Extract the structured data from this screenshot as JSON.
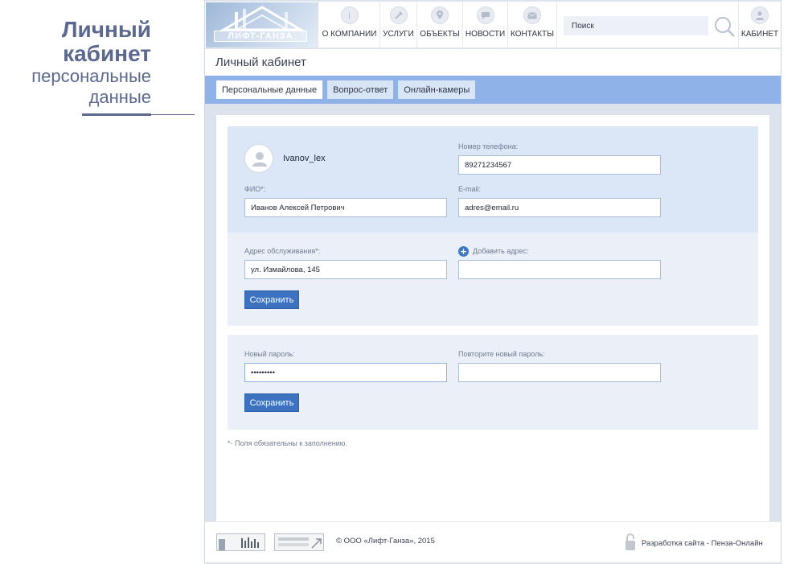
{
  "caption": {
    "title_line1": "Личный",
    "title_line2": "кабинет",
    "subtitle_line1": "персональные",
    "subtitle_line2": "данные"
  },
  "header": {
    "logo_text": "ЛИФТ-ГАНЗА",
    "nav": [
      {
        "label": "О КОМПАНИИ",
        "icon": "info-icon"
      },
      {
        "label": "УСЛУГИ",
        "icon": "wrench-icon"
      },
      {
        "label": "ОБЪЕКТЫ",
        "icon": "map-pin-icon"
      },
      {
        "label": "НОВОСТИ",
        "icon": "chat-icon"
      },
      {
        "label": "КОНТАКТЫ",
        "icon": "mail-icon"
      }
    ],
    "search_placeholder": "Поиск",
    "cabinet_label": "КАБИНЕТ"
  },
  "page_title": "Личный кабинет",
  "tabs": [
    {
      "label": "Персональные данные",
      "active": true
    },
    {
      "label": "Вопрос-ответ",
      "active": false
    },
    {
      "label": "Онлайн-камеры",
      "active": false
    }
  ],
  "profile": {
    "username": "Ivanov_lex",
    "phone_label": "Номер телефона:",
    "phone_value": "89271234567",
    "fio_label": "ФИО*:",
    "fio_value": "Иванов Алексей Петрович",
    "email_label": "E-mail:",
    "email_value": "adres@email.ru"
  },
  "address": {
    "label": "Адрес обслуживания*:",
    "value": "ул. Измайлова, 145",
    "add_label": "Добавить адрес:",
    "add_value": "",
    "save_label": "Сохранить"
  },
  "password": {
    "new_label": "Новый пароль:",
    "new_value": "•••••••••",
    "repeat_label": "Повторите новый пароль:",
    "repeat_value": "",
    "save_label": "Сохранить"
  },
  "required_note": "*- Поля обязательны к заполнению.",
  "footer": {
    "copyright": "© ООО «Лифт-Ганза», 2015",
    "developer": "Разработка сайта - Пенза-Онлайн"
  },
  "colors": {
    "accent": "#3d72c0",
    "tabbar": "#8fb2e8",
    "panel_top": "#dbe6f7",
    "panel": "#ebf0f8",
    "caption": "#5b6890"
  }
}
